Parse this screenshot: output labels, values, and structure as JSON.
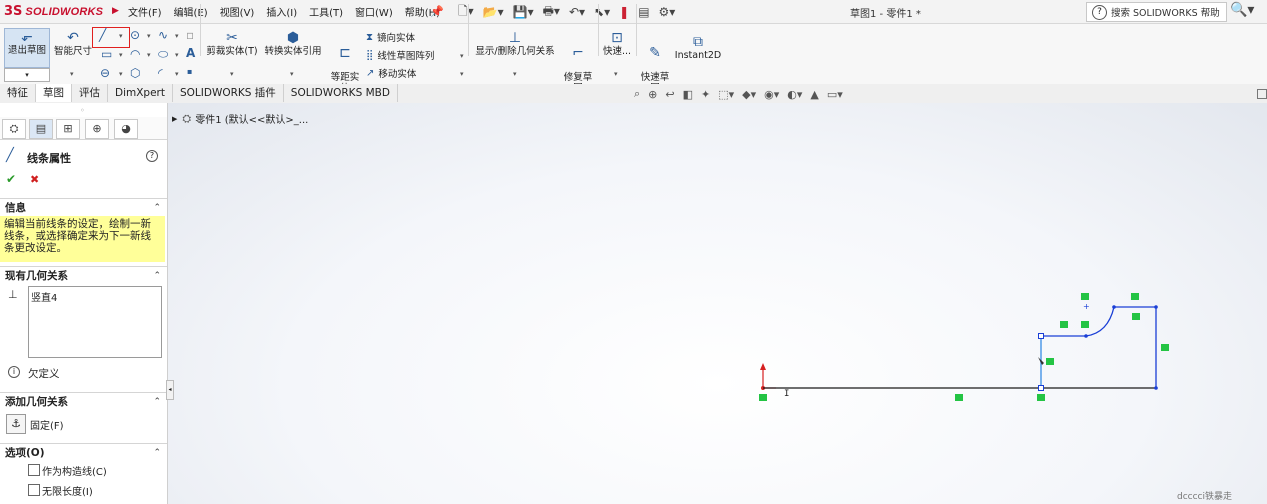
{
  "titlebar": {
    "brand": "SOLIDWORKS",
    "menu": [
      "文件(F)",
      "编辑(E)",
      "视图(V)",
      "插入(I)",
      "工具(T)",
      "窗口(W)",
      "帮助(H)"
    ],
    "doc_title": "草图1 - 零件1 *",
    "search_placeholder": "搜索 SOLIDWORKS 帮助"
  },
  "cmd": {
    "exit_sketch": "退出草图",
    "smart_dim": "智能尺寸",
    "trim": "剪裁实体(T)",
    "convert": "转换实体引用",
    "offset": "等距实\n体",
    "mirror": "镜向实体",
    "linear_pattern": "线性草图阵列",
    "move": "移动实体",
    "show_delete": "显示/删除几何关系",
    "repair": "修复草\n图",
    "quick": "快速...",
    "quick_snap": "快速草\n图",
    "instant2d": "Instant2D"
  },
  "tabs": [
    "特征",
    "草图",
    "评估",
    "DimXpert",
    "SOLIDWORKS 插件",
    "SOLIDWORKS MBD"
  ],
  "active_tab": 1,
  "panel": {
    "title": "线条属性",
    "info_head": "信息",
    "info_text": "编辑当前线条的设定，绘制一新线条，或选择确定来为下一新线条更改设定。",
    "existing_head": "现有几何关系",
    "existing_item": "竖直4",
    "status": "欠定义",
    "add_head": "添加几何关系",
    "fix": "固定(F)",
    "options_head": "选项(O)",
    "opt_construction": "作为构造线(C)",
    "opt_infinite": "无限长度(I)"
  },
  "tree": {
    "item": "零件1 (默认<<默认>_..."
  },
  "watermark": "dcccci铁暴走",
  "colors": {
    "sketch_line": "#1a1a1a",
    "selected_line": "#1a3fd6",
    "relation_tag": "#24c444",
    "origin": "#d62020"
  }
}
